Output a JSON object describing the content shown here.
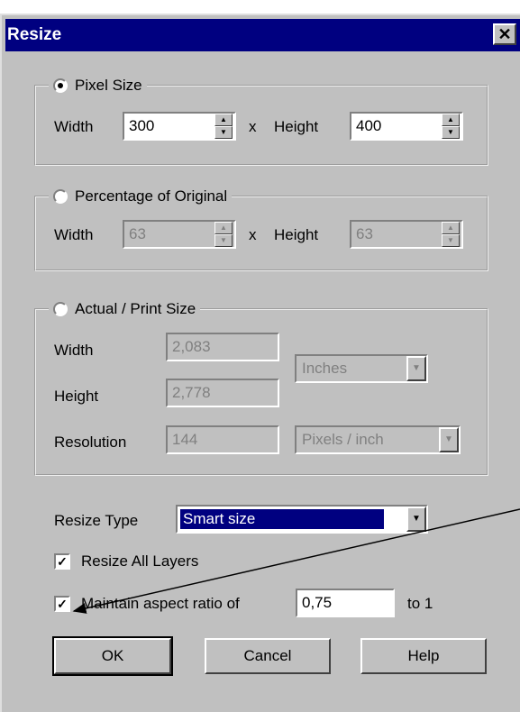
{
  "window": {
    "title": "Resize",
    "close_glyph": "✕"
  },
  "pixel_size": {
    "label": "Pixel Size",
    "selected": true,
    "width_label": "Width",
    "width_value": "300",
    "times": "x",
    "height_label": "Height",
    "height_value": "400"
  },
  "percentage": {
    "label": "Percentage of Original",
    "selected": false,
    "width_label": "Width",
    "width_value": "63",
    "times": "x",
    "height_label": "Height",
    "height_value": "63"
  },
  "actual": {
    "label": "Actual / Print Size",
    "selected": false,
    "width_label": "Width",
    "width_value": "2,083",
    "height_label": "Height",
    "height_value": "2,778",
    "resolution_label": "Resolution",
    "resolution_value": "144",
    "units_value": "Inches",
    "res_units_value": "Pixels / inch"
  },
  "resize_type": {
    "label": "Resize Type",
    "value": "Smart size"
  },
  "resize_all_layers": {
    "label": "Resize All Layers",
    "checked": true
  },
  "aspect": {
    "label": "Maintain aspect ratio of",
    "checked": true,
    "value": "0,75",
    "suffix": "to 1"
  },
  "buttons": {
    "ok": "OK",
    "cancel": "Cancel",
    "help": "Help"
  },
  "icons": {
    "close": "close-icon",
    "spin_up": "spin-up-icon",
    "spin_down": "spin-down-icon",
    "dropdown": "chevron-down-icon",
    "check": "checkmark-icon"
  },
  "colors": {
    "face": "#c0c0c0",
    "titlebar": "#000080",
    "highlight": "#000080"
  }
}
